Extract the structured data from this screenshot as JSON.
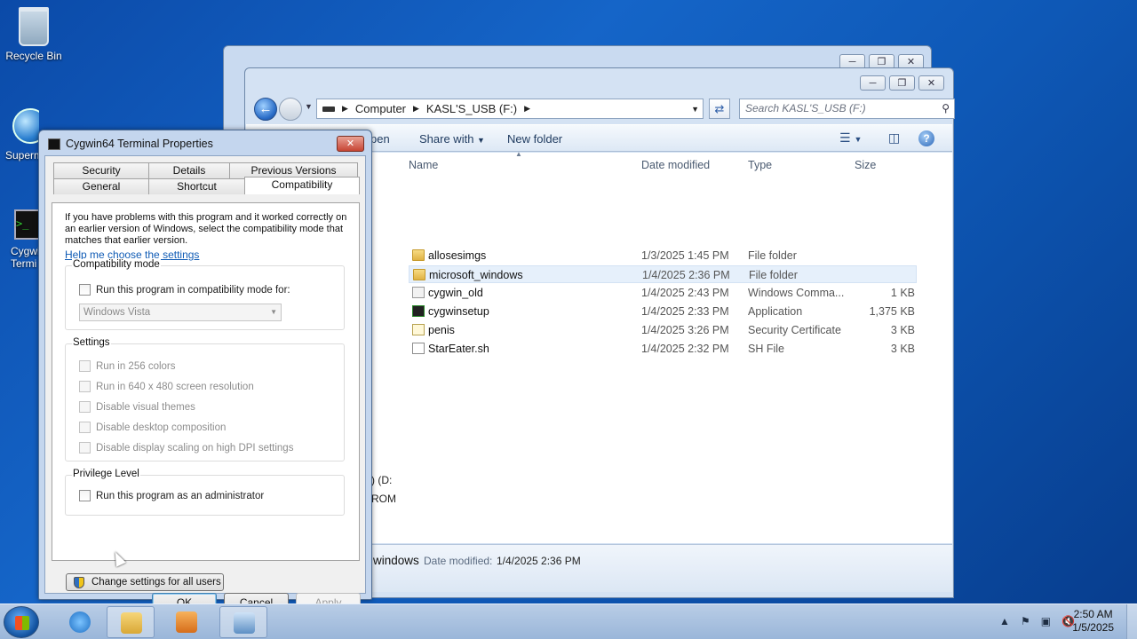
{
  "desktop": {
    "icons": [
      {
        "label": "Recycle Bin"
      },
      {
        "label": "Superm"
      },
      {
        "label": "Cygwi",
        "label2": "Termi"
      }
    ]
  },
  "explorer": {
    "address": {
      "crumbs": [
        "Computer",
        "KASL'S_USB (F:)"
      ]
    },
    "search_placeholder": "Search KASL'S_USB (F:)",
    "toolbar": {
      "open": "pen",
      "share": "Share with",
      "new_folder": "New folder"
    },
    "columns": {
      "name": "Name",
      "date": "Date modified",
      "type": "Type",
      "size": "Size"
    },
    "files": [
      {
        "name": "allosesimgs",
        "date": "1/3/2025 1:45 PM",
        "type": "File folder",
        "size": "",
        "icon": "folder-icon"
      },
      {
        "name": "microsoft_windows",
        "date": "1/4/2025 2:36 PM",
        "type": "File folder",
        "size": "",
        "icon": "folder-icon"
      },
      {
        "name": "cygwin_old",
        "date": "1/4/2025 2:43 PM",
        "type": "Windows Comma...",
        "size": "1 KB",
        "icon": "shortcut-icon"
      },
      {
        "name": "cygwinsetup",
        "date": "1/4/2025 2:33 PM",
        "type": "Application",
        "size": "1,375 KB",
        "icon": "app-icon"
      },
      {
        "name": "penis",
        "date": "1/4/2025 3:26 PM",
        "type": "Security Certificate",
        "size": "3 KB",
        "icon": "certificate-icon"
      },
      {
        "name": "StarEater.sh",
        "date": "1/4/2025 2:32 PM",
        "type": "SH File",
        "size": "3 KB",
        "icon": "file-icon"
      }
    ],
    "nav_fragments": [
      ") (D:",
      "ROM"
    ],
    "details": {
      "name": "windows",
      "label": "Date modified:",
      "value": "1/4/2025 2:36 PM"
    }
  },
  "dialog": {
    "title": "Cygwin64 Terminal Properties",
    "tabs_row1": [
      "Security",
      "Details",
      "Previous Versions"
    ],
    "tabs_row2": [
      "General",
      "Shortcut",
      "Compatibility"
    ],
    "intro": "If you have problems with this program and it worked correctly on an earlier version of Windows, select the compatibility mode that matches that earlier version.",
    "help_link": "Help me choose the settings",
    "compat_group": "Compatibility mode",
    "compat_checkbox": "Run this program in compatibility mode for:",
    "compat_select": "Windows Vista",
    "settings_group": "Settings",
    "settings": [
      "Run in 256 colors",
      "Run in 640 x 480 screen resolution",
      "Disable visual themes",
      "Disable desktop composition",
      "Disable display scaling on high DPI settings"
    ],
    "privilege_group": "Privilege Level",
    "admin_checkbox": "Run this program as an administrator",
    "change_all": "Change settings for all users",
    "ok": "OK",
    "cancel": "Cancel",
    "apply": "Apply"
  },
  "taskbar": {
    "time": "2:50 AM",
    "date": "1/5/2025"
  }
}
